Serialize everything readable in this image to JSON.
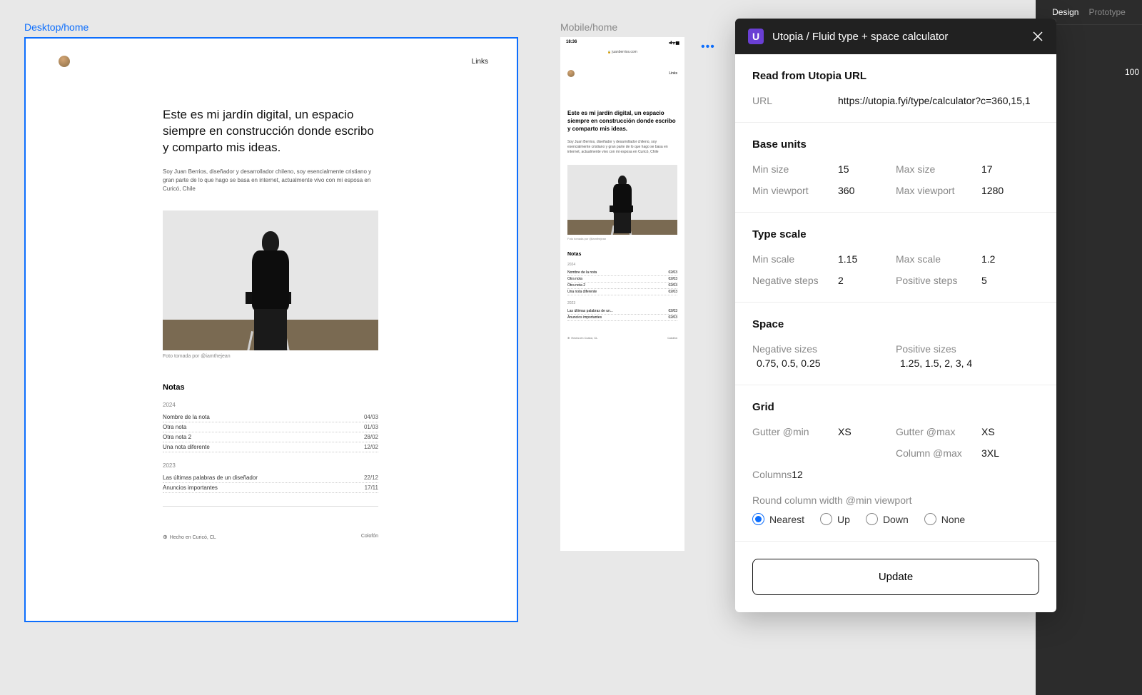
{
  "frames": {
    "desktop_label": "Desktop/home",
    "mobile_label": "Mobile/home"
  },
  "right_panel": {
    "tab_design": "Design",
    "tab_prototype": "Prototype",
    "value_100": "100"
  },
  "site": {
    "nav_links": "Links",
    "hero": "Este es mi jardín digital, un espacio siempre en construcción donde escribo y comparto mis ideas.",
    "bio": "Soy Juan Berrios, diseñador y desarrollador chileno, soy esencialmente cristiano y gran parte de lo que hago se basa en internet, actualmente vivo con mi esposa en Curicó, Chile",
    "photo_caption": "Foto tomada por @iamthejean",
    "notas_heading": "Notas",
    "years": [
      {
        "year": "2024",
        "notes": [
          {
            "title": "Nombre de la nota",
            "date": "04/03"
          },
          {
            "title": "Otra nota",
            "date": "01/03"
          },
          {
            "title": "Otra nota 2",
            "date": "28/02"
          },
          {
            "title": "Una nota diferente",
            "date": "12/02"
          }
        ]
      },
      {
        "year": "2023",
        "notes": [
          {
            "title": "Las últimas palabras de un diseñador",
            "date": "22/12"
          },
          {
            "title": "Anuncios importantes",
            "date": "17/11"
          }
        ]
      }
    ],
    "footer_location": "Hecho en Curicó, CL",
    "footer_colophon": "Colofón"
  },
  "mobile": {
    "status_time": "18:36",
    "status_icons": "••ll ᯤ ▮▮",
    "url": "juanberrios.com",
    "years": [
      {
        "year": "2024",
        "notes": [
          {
            "title": "Nombre de la nota",
            "date": "02/03"
          },
          {
            "title": "Otra nota",
            "date": "02/03"
          },
          {
            "title": "Otra nota 2",
            "date": "02/03"
          },
          {
            "title": "Una nota diferente",
            "date": "02/03"
          }
        ]
      },
      {
        "year": "2023",
        "notes": [
          {
            "title": "Las últimas palabras de un...",
            "date": "02/03"
          },
          {
            "title": "Anuncios importantes",
            "date": "02/03"
          }
        ]
      }
    ]
  },
  "plugin": {
    "title": "Utopia / Fluid type + space calculator",
    "sections": {
      "url_heading": "Read from Utopia URL",
      "url_label": "URL",
      "url_value": "https://utopia.fyi/type/calculator?c=360,15,1",
      "base_heading": "Base units",
      "min_size_label": "Min size",
      "min_size_value": "15",
      "max_size_label": "Max size",
      "max_size_value": "17",
      "min_vp_label": "Min viewport",
      "min_vp_value": "360",
      "max_vp_label": "Max viewport",
      "max_vp_value": "1280",
      "type_heading": "Type scale",
      "min_scale_label": "Min scale",
      "min_scale_value": "1.15",
      "max_scale_label": "Max scale",
      "max_scale_value": "1.2",
      "neg_steps_label": "Negative steps",
      "neg_steps_value": "2",
      "pos_steps_label": "Positive steps",
      "pos_steps_value": "5",
      "space_heading": "Space",
      "neg_sizes_label": "Negative sizes",
      "neg_sizes_value": "0.75, 0.5, 0.25",
      "pos_sizes_label": "Positive sizes",
      "pos_sizes_value": "1.25, 1.5, 2, 3, 4",
      "grid_heading": "Grid",
      "gutter_min_label": "Gutter @min",
      "gutter_min_value": "XS",
      "gutter_max_label": "Gutter @max",
      "gutter_max_value": "XS",
      "column_max_label": "Column @max",
      "column_max_value": "3XL",
      "columns_label": "Columns",
      "columns_value": "12",
      "round_label": "Round column width @min viewport",
      "radio_nearest": "Nearest",
      "radio_up": "Up",
      "radio_down": "Down",
      "radio_none": "None",
      "update_button": "Update"
    }
  }
}
